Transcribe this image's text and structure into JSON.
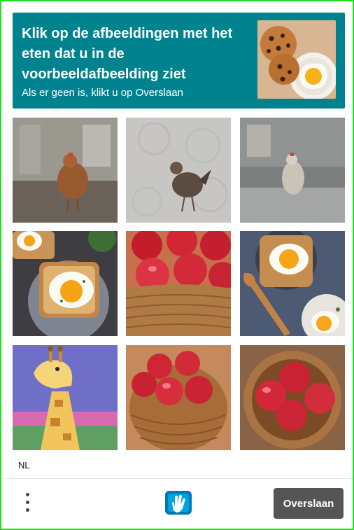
{
  "prompt": {
    "title": "Klik op de afbeeldingen met het eten dat u in de voorbeeldafbeelding ziet",
    "subtitle": "Als er geen is, klikt u op Overslaan",
    "example_image_icon": "cookies-and-fried-egg-image"
  },
  "grid": {
    "tiles": [
      {
        "icon": "chicken-image"
      },
      {
        "icon": "chicken-image"
      },
      {
        "icon": "chicken-image"
      },
      {
        "icon": "egg-toast-image"
      },
      {
        "icon": "apple-basket-image"
      },
      {
        "icon": "egg-toast-image"
      },
      {
        "icon": "giraffe-image"
      },
      {
        "icon": "apple-basket-image"
      },
      {
        "icon": "apple-basket-image"
      }
    ]
  },
  "footer": {
    "language": "NL",
    "menu_icon": "more-vertical-icon",
    "logo_icon": "hcaptcha-logo-icon",
    "skip_label": "Overslaan"
  },
  "colors": {
    "header_bg": "#00838f",
    "frame_border": "#22dd22",
    "skip_button_bg": "#555555"
  }
}
